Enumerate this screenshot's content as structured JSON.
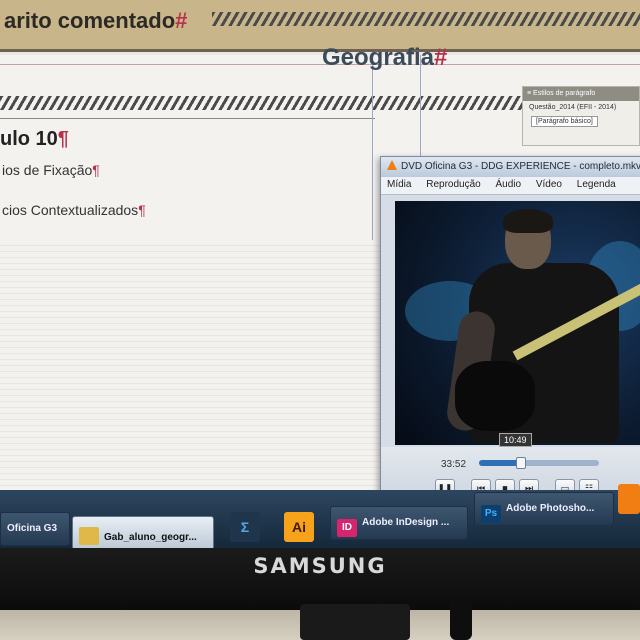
{
  "document": {
    "header_title": "arito comentado",
    "pilcrow": "#",
    "subject": "Geografia",
    "subject_mark": "#",
    "chapter": "ulo 10",
    "chapter_mark": "¶",
    "items": [
      {
        "label": "ios de Fixação",
        "mark": "¶"
      },
      {
        "label": "cios Contextualizados",
        "mark": "¶"
      }
    ]
  },
  "paragraph_panel": {
    "title": "≡ Estilos de parágrafo",
    "entry": "Questão_2014 (EFII - 2014)",
    "button": "[Parágrafo básico]"
  },
  "vlc": {
    "title": "DVD Oficina G3 - DDG EXPERIENCE - completo.mkv",
    "menu": [
      "Mídia",
      "Reprodução",
      "Áudio",
      "Vídeo",
      "Legenda"
    ],
    "elapsed": "33:52",
    "hover_time": "10:49",
    "progress": 0.35,
    "buttons": [
      "❚❚",
      "⏮",
      "■",
      "⏭",
      "▭",
      "☷"
    ]
  },
  "taskbar": {
    "items": [
      {
        "label": "Oficina G3",
        "icon": "vlc-icon"
      },
      {
        "label": "Gab_aluno_geogr...",
        "icon": "folder-icon"
      },
      {
        "label": "Adobe InDesign ...",
        "icon": "indesign-icon",
        "badge": "ID"
      },
      {
        "label": "Adobe Photosho...",
        "icon": "photoshop-icon",
        "badge": "Ps"
      }
    ],
    "pinned": [
      {
        "icon": "sigma-icon",
        "glyph": "Σ"
      },
      {
        "icon": "illustrator-icon",
        "glyph": "Ai"
      }
    ]
  },
  "monitor": {
    "brand": "SAMSUNG"
  }
}
